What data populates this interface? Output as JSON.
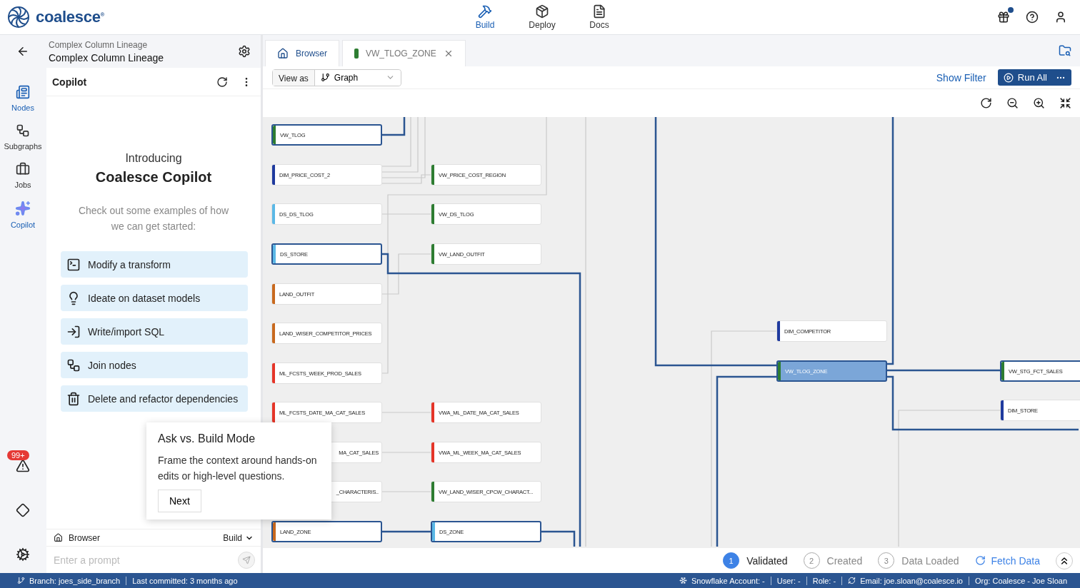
{
  "logo": "coalesce$^{®}$",
  "top_nav": [
    {
      "label": "Build",
      "selected": true
    },
    {
      "label": "Deploy",
      "selected": false
    },
    {
      "label": "Docs",
      "selected": false
    }
  ],
  "gift_badge": true,
  "rail": [
    {
      "label": "Nodes",
      "selected": true
    },
    {
      "label": "Subgraphs",
      "selected": false
    },
    {
      "label": "Jobs",
      "selected": false
    },
    {
      "label": "Copilot",
      "selected": true
    }
  ],
  "rail_badge": "99+",
  "project": {
    "breadcrumb": "Complex Column Lineage",
    "title": "Complex Column Lineage"
  },
  "copilot": {
    "title": "Copilot",
    "intro": "Introducing",
    "heading": "Coalesce Copilot",
    "description": "Check out some examples of how we can get started:",
    "suggestions": [
      "Modify a transform",
      "Ideate on dataset models",
      "Write/import SQL",
      "Join nodes",
      "Delete and refactor dependencies"
    ],
    "context": "Browser",
    "mode": "Build",
    "prompt_placeholder": "Enter a prompt"
  },
  "tooltip": {
    "title": "Ask vs. Build Mode",
    "body": "Frame the context around hands-on edits or high-level questions.",
    "button": "Next"
  },
  "tabs": [
    {
      "label": "Browser",
      "kind": "home",
      "selected": true
    },
    {
      "label": "VW_TLOG_ZONE",
      "kind": "node",
      "color": "#2e7d32",
      "selected": false
    }
  ],
  "toolbar": {
    "view_as_label": "View as",
    "view": "Graph",
    "show_filter": "Show Filter",
    "run": "Run All"
  },
  "graph": {
    "nodes": [
      {
        "label": "VW_TLOG",
        "color": "#2e7d32",
        "highlighted": true,
        "selected": false,
        "covered": false
      },
      {
        "label": "DIM_PRICE_COST_2",
        "color": "#1f3a9e",
        "highlighted": false,
        "selected": false,
        "covered": false
      },
      {
        "label": "DS_DS_TLOG",
        "color": "#5bb8e6",
        "highlighted": false,
        "selected": false,
        "covered": false
      },
      {
        "label": "DS_STORE",
        "color": "#5bb8e6",
        "highlighted": true,
        "selected": false,
        "covered": false
      },
      {
        "label": "LAND_OUTFIT",
        "color": "#c8691e",
        "highlighted": false,
        "selected": false,
        "covered": false
      },
      {
        "label": "LAND_WISER_COMPETITOR_PRICES",
        "color": "#c8691e",
        "highlighted": false,
        "selected": false,
        "covered": false
      },
      {
        "label": "ML_FCSTS_WEEK_PROD_SALES",
        "color": "#e53528",
        "highlighted": false,
        "selected": false,
        "covered": false
      },
      {
        "label": "ML_FCSTS_DATE_MA_CAT_SALES",
        "color": "#e53528",
        "highlighted": false,
        "selected": false,
        "covered": false
      },
      {
        "label": "MA_CAT_SALES",
        "highlighted": false,
        "selected": false,
        "covered": true
      },
      {
        "label": "_CHARACTERIS..",
        "highlighted": false,
        "selected": false,
        "covered": true
      },
      {
        "label": "LAND_ZONE",
        "color": "#c8691e",
        "highlighted": true,
        "selected": false,
        "covered": false
      },
      {
        "label": "VW_PRICE_COST_REGION",
        "color": "#2e7d32",
        "highlighted": false,
        "selected": false,
        "covered": false
      },
      {
        "label": "VW_DS_TLOG",
        "color": "#2e7d32",
        "highlighted": false,
        "selected": false,
        "covered": false
      },
      {
        "label": "VW_LAND_OUTFIT",
        "color": "#2e7d32",
        "highlighted": false,
        "selected": false,
        "covered": false
      },
      {
        "label": "VWA_ML_DATE_MA_CAT_SALES",
        "color": "#e53528",
        "highlighted": false,
        "selected": false,
        "covered": false
      },
      {
        "label": "VWA_ML_WEEK_MA_CAT_SALES",
        "color": "#e53528",
        "highlighted": false,
        "selected": false,
        "covered": false
      },
      {
        "label": "VW_LAND_WISER_CPCW_CHARACT...",
        "color": "#2e7d32",
        "highlighted": false,
        "selected": false,
        "covered": false
      },
      {
        "label": "DS_ZONE",
        "color": "#5bb8e6",
        "highlighted": true,
        "selected": false,
        "covered": false
      },
      {
        "label": "DIM_COMPETITOR",
        "color": "#1f3a9e",
        "highlighted": false,
        "selected": false,
        "covered": false
      },
      {
        "label": "VW_TLOG_ZONE",
        "color": "#2e7d32",
        "highlighted": true,
        "selected": true,
        "covered": false
      },
      {
        "label": "VW_STG_FCT_SALES",
        "color": "#2e7d32",
        "highlighted": true,
        "selected": false,
        "covered": false
      },
      {
        "label": "DIM_STORE",
        "color": "#1f3a9e",
        "highlighted": false,
        "selected": false,
        "covered": false
      }
    ]
  },
  "steps": [
    {
      "number": "1",
      "label": "Validated",
      "selected": true
    },
    {
      "number": "2",
      "label": "Created",
      "selected": false
    },
    {
      "number": "3",
      "label": "Data Loaded",
      "selected": false
    }
  ],
  "fetch": "Fetch Data",
  "status_bar": {
    "left": [
      "Branch: joes_side_branch",
      "Last committed: 3 months ago"
    ],
    "right": [
      "Snowflake Account: -",
      "User: -",
      "Role: -",
      "Email: joe.sloan@coalesce.io",
      "Org: Coalesce - Joe Sloan"
    ]
  }
}
